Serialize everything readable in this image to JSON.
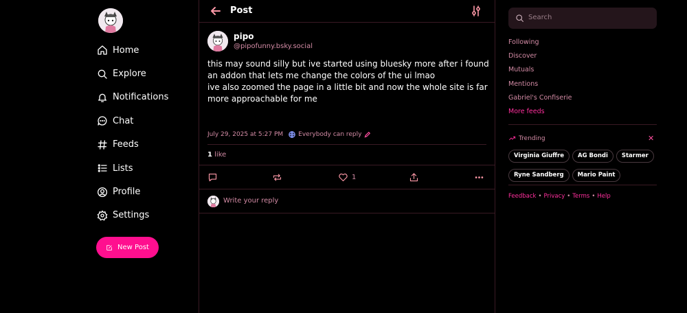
{
  "nav": {
    "items": [
      {
        "label": "Home",
        "icon": "home-icon"
      },
      {
        "label": "Explore",
        "icon": "search-icon"
      },
      {
        "label": "Notifications",
        "icon": "bell-icon"
      },
      {
        "label": "Chat",
        "icon": "chat-bubble-icon"
      },
      {
        "label": "Feeds",
        "icon": "hashtag-icon"
      },
      {
        "label": "Lists",
        "icon": "list-icon"
      },
      {
        "label": "Profile",
        "icon": "user-circle-icon"
      },
      {
        "label": "Settings",
        "icon": "gear-icon"
      }
    ],
    "new_post_label": "New Post"
  },
  "header": {
    "title": "Post"
  },
  "post": {
    "author_name": "pipo",
    "author_handle": "@pipofunny.bsky.social",
    "text_line1": "this may sound silly but ive started using bluesky more after i found an addon that lets me change the colors of the ui lmao",
    "text_line2": "ive also zoomed the page in a little bit and now the whole site is far more approachable for me",
    "timestamp": "July 29, 2025 at 5:27 PM",
    "reply_setting": "Everybody can reply",
    "like_count": "1",
    "like_word": "like",
    "action_like_count": "1"
  },
  "reply": {
    "placeholder": "Write your reply"
  },
  "search": {
    "placeholder": "Search"
  },
  "feeds": [
    "Following",
    "Discover",
    "Mutuals",
    "Mentions",
    "Gabriel's Confiserie"
  ],
  "more_feeds": "More feeds",
  "trending": {
    "title": "Trending",
    "topics": [
      "Virginia Giuffre",
      "AG Bondi",
      "Starmer",
      "Ryne Sandberg",
      "Mario Paint"
    ]
  },
  "footer": {
    "feedback": "Feedback",
    "privacy": "Privacy",
    "terms": "Terms",
    "help": "Help"
  },
  "colors": {
    "accent": "#ff0f8f",
    "muted_pink": "#d38ba5",
    "border": "#3a1a24",
    "background": "#000000"
  }
}
